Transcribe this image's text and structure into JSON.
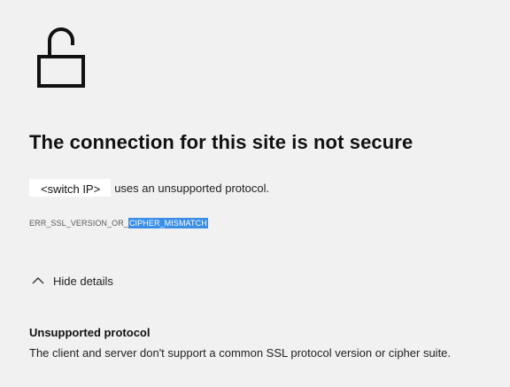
{
  "icons": {
    "lock": "unlocked-padlock-icon",
    "toggle": "chevron-up-icon"
  },
  "error_page": {
    "title": "The connection for this site is not secure",
    "host": "<switch IP>",
    "message": "uses an unsupported protocol.",
    "error_code_prefix": "ERR_SSL_VERSION_OR_",
    "error_code_selected": "CIPHER_MISMATCH",
    "details_toggle_label": "Hide details",
    "details_heading": "Unsupported protocol",
    "details_body": "The client and server don't support a common SSL protocol version or cipher suite."
  },
  "colors": {
    "background": "#f1f1f1",
    "selection": "#3a8ee6",
    "host_chip": "#ffffff"
  }
}
